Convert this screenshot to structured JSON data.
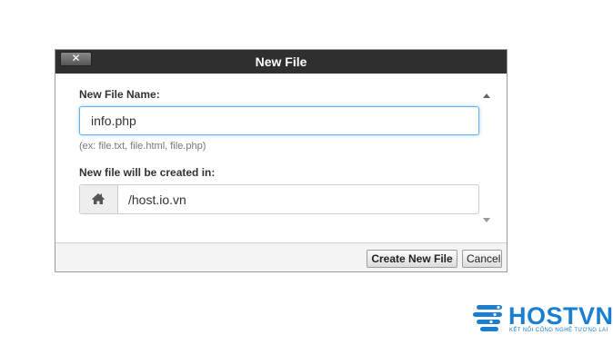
{
  "dialog": {
    "title": "New File",
    "close_label": "✕",
    "file_name_label": "New File Name:",
    "file_name_value": "info.php",
    "file_name_hint": "(ex: file.txt, file.html, file.php)",
    "location_label": "New file will be created in:",
    "location_value": "/host.io.vn",
    "create_button": "Create New File",
    "cancel_button": "Cancel"
  },
  "logo": {
    "name": "HOSTVN",
    "tagline": "KẾT NỐI CÔNG NGHỆ TƯƠNG LAI",
    "color": "#1a7fd0"
  },
  "icons": {
    "close": "close-icon",
    "home": "home-icon",
    "scroll_up": "scroll-up-arrow-icon",
    "scroll_down": "scroll-down-arrow-icon"
  },
  "colors": {
    "titlebar": "#2f2f2f",
    "focus_border": "#66afe9"
  }
}
